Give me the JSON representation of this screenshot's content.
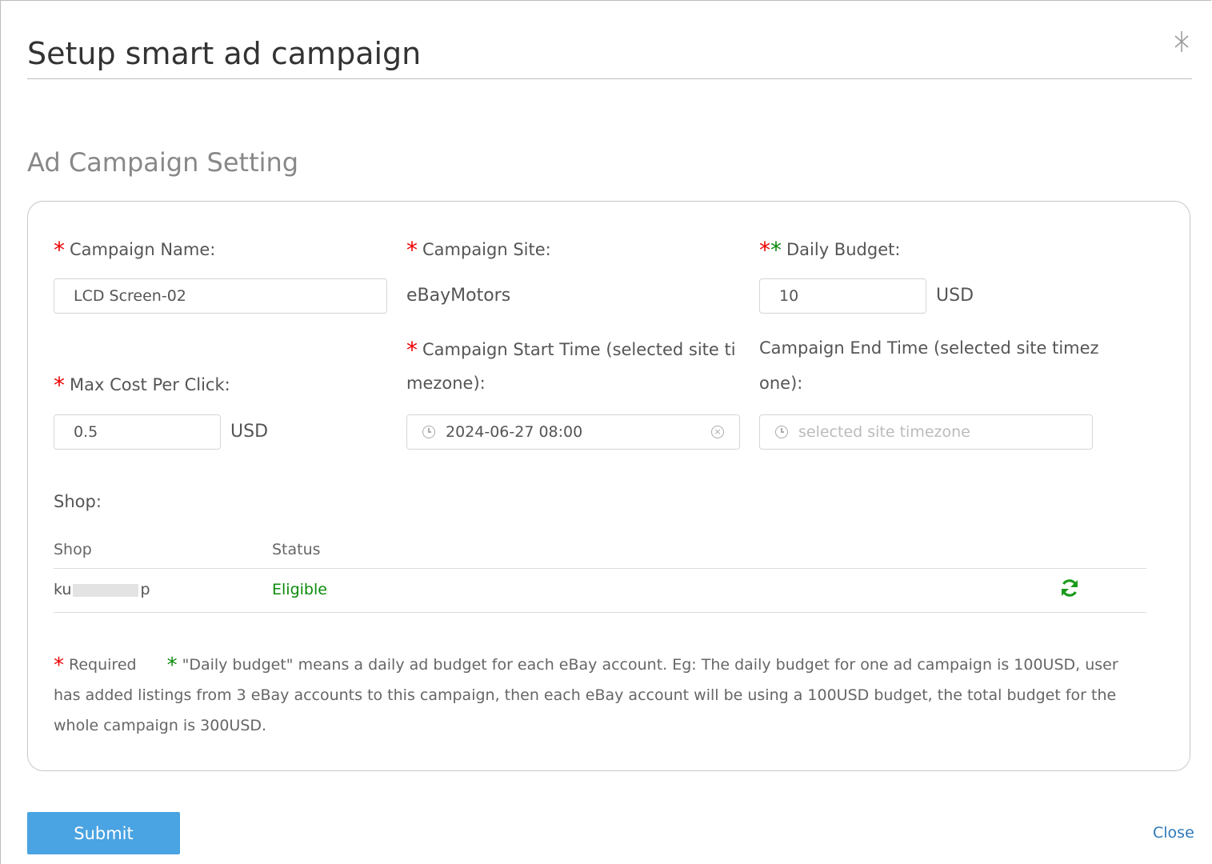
{
  "dialog": {
    "title": "Setup smart ad campaign",
    "close_label": "Close"
  },
  "section": {
    "title": "Ad Campaign Setting"
  },
  "form": {
    "campaign_name": {
      "label": "Campaign Name:",
      "value": "LCD Screen-02"
    },
    "campaign_site": {
      "label": "Campaign Site:",
      "value": "eBayMotors"
    },
    "daily_budget": {
      "label": "Daily Budget:",
      "value": "10",
      "unit": "USD"
    },
    "max_cpc": {
      "label": "Max Cost Per Click:",
      "value": "0.5",
      "unit": "USD"
    },
    "start_time": {
      "label_line1": "Campaign Start Time (selected site ti",
      "label_line2": "mezone):",
      "value": "2024-06-27 08:00"
    },
    "end_time": {
      "label_line1": "Campaign End Time (selected site timez",
      "label_line2": "one):",
      "placeholder": "selected site timezone"
    }
  },
  "shop": {
    "label": "Shop:",
    "columns": [
      "Shop",
      "Status"
    ],
    "rows": [
      {
        "shop_start": "ku",
        "shop_end": "p",
        "status": "Eligible"
      }
    ]
  },
  "notes": {
    "required_label": "Required",
    "budget_note": "\"Daily budget\" means a daily ad budget for each eBay account. Eg: The daily budget for one ad campaign is 100USD, user has added listings from 3 eBay accounts to this campaign, then each eBay account will be using a 100USD budget, the total budget for the whole campaign is 300USD."
  },
  "actions": {
    "submit": "Submit",
    "close": "Close"
  },
  "icons": {
    "close": "close-icon",
    "clock": "clock-icon",
    "clear": "clear-icon",
    "refresh": "refresh-icon"
  },
  "colors": {
    "required": "#ee0000",
    "note_star": "#0a8a0a",
    "status_ok": "#0a8a0a",
    "submit_bg": "#4aa3e2",
    "link": "#2f79b9"
  }
}
